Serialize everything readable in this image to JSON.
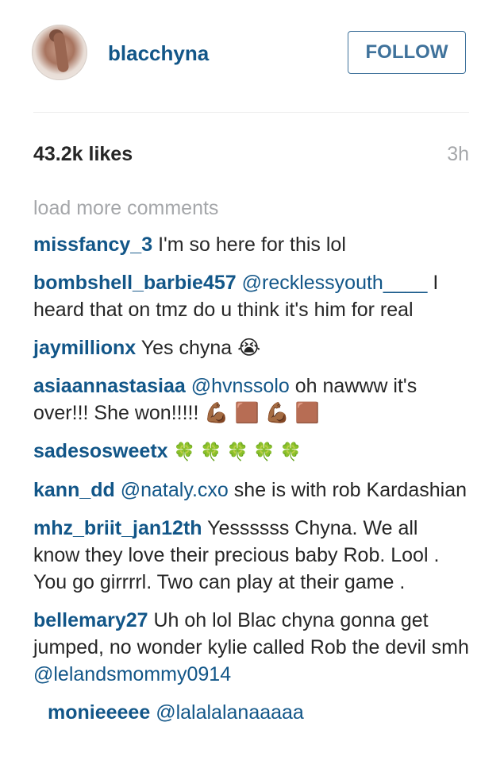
{
  "header": {
    "username": "blacchyna",
    "follow_label": "FOLLOW",
    "accent": "#125688",
    "button_color": "#3f729b"
  },
  "stats": {
    "likes": "43.2k likes",
    "time": "3h"
  },
  "load_more": "load more comments",
  "comments": [
    {
      "user": "missfancy_3",
      "pre": "I'm so here for this lol",
      "mention": "",
      "post": ""
    },
    {
      "user": "bombshell_barbie457",
      "pre": "",
      "mention": "@recklessyouth____",
      "post": " I heard that on tmz do u think it's him for real"
    },
    {
      "user": "jaymillionx",
      "pre": "Yes chyna 😭",
      "mention": "",
      "post": ""
    },
    {
      "user": "asiaannastasiaa",
      "pre": "",
      "mention": "@hvnssolo",
      "post": " oh nawww it's over!!! She won!!!!! 💪🏾 🟫 💪🏾 🟫"
    },
    {
      "user": "sadesosweetx",
      "pre": "🍀 🍀 🍀 🍀 🍀",
      "mention": "",
      "post": ""
    },
    {
      "user": "kann_dd",
      "pre": "",
      "mention": "@nataly.cxo",
      "post": " she is with rob Kardashian"
    },
    {
      "user": "mhz_briit_jan12th",
      "pre": "Yessssss Chyna. We all know they love their precious baby Rob. Lool . You go girrrrl. Two can play at their game .",
      "mention": "",
      "post": ""
    },
    {
      "user": "bellemary27",
      "pre": "Uh oh lol Blac chyna gonna get jumped, no wonder kylie called Rob the devil smh ",
      "mention": "@lelandsmommy0914",
      "post": ""
    },
    {
      "user": "monieeeee",
      "pre": "",
      "mention": "@lalalalanaaaaa",
      "post": ""
    }
  ]
}
